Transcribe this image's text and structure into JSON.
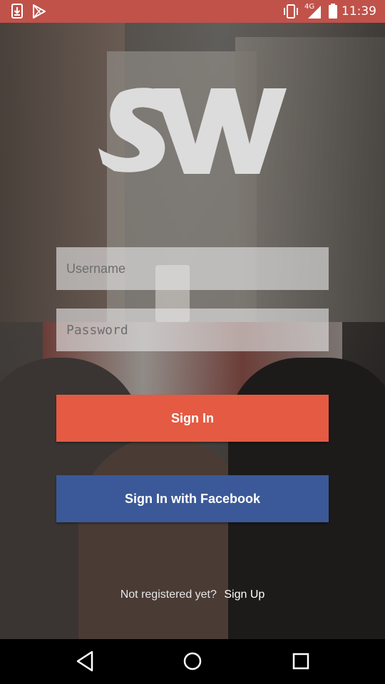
{
  "status_bar": {
    "time": "11:39",
    "network": "4G",
    "background_color": "#c0524a",
    "icons": [
      "download-icon",
      "play-store-icon",
      "vibrate-icon",
      "signal-icon",
      "battery-icon"
    ]
  },
  "logo": {
    "icon": "sw-logo-icon",
    "color": "#dcdcdc"
  },
  "login": {
    "username_placeholder": "Username",
    "password_placeholder": "Password",
    "signin_label": "Sign In",
    "signin_color": "#e55a43",
    "facebook_label": "Sign In with Facebook",
    "facebook_color": "#3b5998"
  },
  "signup": {
    "prompt": "Not registered yet?",
    "link_label": "Sign Up"
  },
  "nav_bar": {
    "icons": [
      "back-icon",
      "home-icon",
      "recents-icon"
    ]
  }
}
